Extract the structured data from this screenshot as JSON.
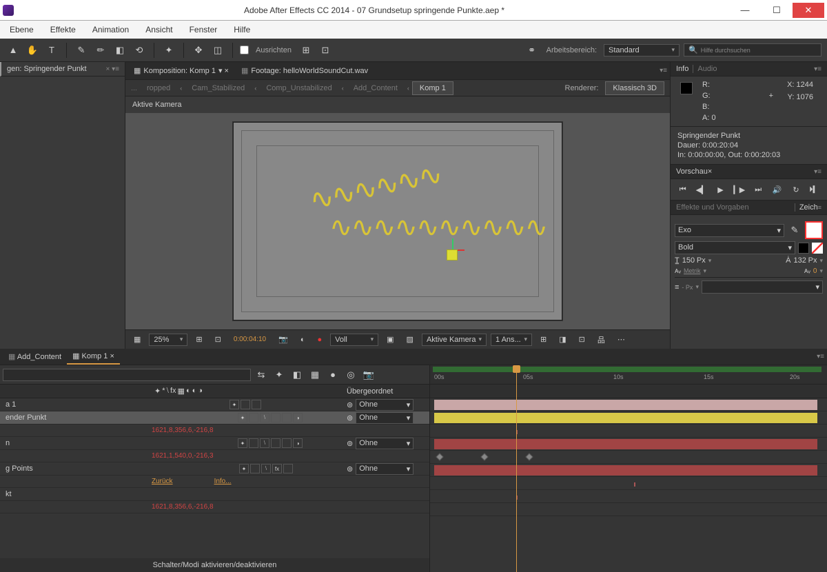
{
  "titlebar": {
    "title": "Adobe After Effects CC 2014 - 07 Grundsetup springende Punkte.aep *"
  },
  "menubar": [
    "Ebene",
    "Effekte",
    "Animation",
    "Ansicht",
    "Fenster",
    "Hilfe"
  ],
  "toolbar": {
    "align_label": "Ausrichten",
    "workspace_label": "Arbeitsbereich:",
    "workspace_value": "Standard",
    "search_placeholder": "Hilfe durchsuchen"
  },
  "project_tab": "gen: Springender Punkt",
  "comp_tabs": {
    "composition": "Komposition: Komp 1",
    "footage": "Footage: helloWorldSoundCut.wav"
  },
  "flow_tabs": [
    "ropped",
    "Cam_Stabilized",
    "Comp_Unstabilized",
    "Add_Content",
    "Komp 1"
  ],
  "renderer_label": "Renderer:",
  "renderer_value": "Klassisch 3D",
  "active_cam": "Aktive Kamera",
  "viewer_footer": {
    "zoom": "25%",
    "time": "0:00:04:10",
    "res": "Voll",
    "view": "Aktive Kamera",
    "views": "1 Ans..."
  },
  "info_panel": {
    "tab1": "Info",
    "tab2": "Audio",
    "r": "R:",
    "g": "G:",
    "b": "B:",
    "a": "A:  0",
    "x": "X: 1244",
    "y": "Y: 1076",
    "layer_name": "Springender Punkt",
    "duration": "Dauer: 0:00:20:04",
    "inout": "In: 0:00:00:00, Out: 0:00:20:03"
  },
  "preview_tab": "Vorschau",
  "fx_tab1": "Effekte und Vorgaben",
  "fx_tab2": "Zeich",
  "char": {
    "font": "Exo",
    "weight": "Bold",
    "size": "150",
    "size_unit": "Px",
    "leading": "132",
    "leading_unit": "Px",
    "kern": "Metrik",
    "track": "0",
    "px_dash": "- Px"
  },
  "timeline": {
    "tab1": "Add_Content",
    "tab2": "Komp 1",
    "header_parent": "Übergeordnet",
    "layers": {
      "l1": "a 1",
      "l2": "ender Punkt",
      "l2_pos": "1621,8,356,6,-216,8",
      "l3": "n",
      "l3_pos": "1621,1,540,0,-216,3",
      "l4": "g Points",
      "l4_back": "Zurück",
      "l4_info": "Info...",
      "l5": "kt",
      "l5_pos": "1621,8,356,6,-216,8",
      "parent_none": "Ohne"
    },
    "footer": "Schalter/Modi aktivieren/deaktivieren",
    "ruler": [
      "00s",
      "05s",
      "10s",
      "15s",
      "20s"
    ]
  }
}
